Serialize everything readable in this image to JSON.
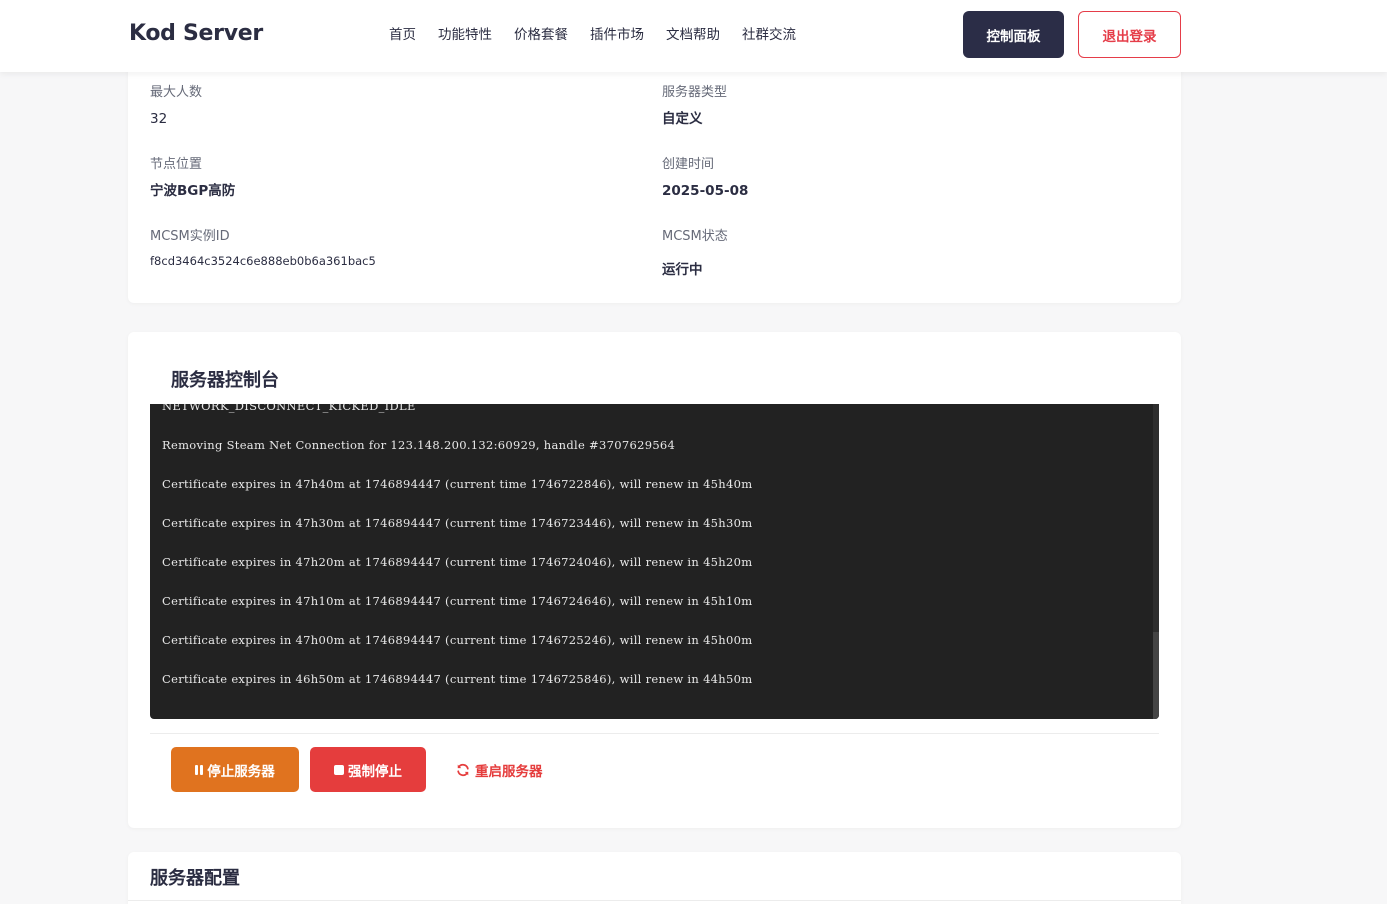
{
  "brand": {
    "name": "Kod Server"
  },
  "nav": {
    "links": [
      "首页",
      "功能特性",
      "价格套餐",
      "插件市场",
      "文档帮助",
      "社群交流"
    ],
    "dashboard_label": "控制面板",
    "logout_label": "退出登录"
  },
  "server_info": {
    "max_players_label": "最大人数",
    "max_players_value": "32",
    "server_type_label": "服务器类型",
    "server_type_value": "自定义",
    "node_label": "节点位置",
    "node_value": "宁波BGP高防",
    "created_label": "创建时间",
    "created_value": "2025-05-08",
    "mcsm_id_label": "MCSM实例ID",
    "mcsm_id_value": "f8cd3464c3524c6e888eb0b6a361bac5",
    "mcsm_status_label": "MCSM状态",
    "mcsm_status_value": "运行中"
  },
  "console": {
    "title": "服务器控制台",
    "lines": [
      "NETWORK_DISCONNECT_KICKED_IDLE",
      "Removing Steam Net Connection for 123.148.200.132:60929, handle #3707629564",
      "Certificate expires in 47h40m at 1746894447 (current time 1746722846), will renew in 45h40m",
      "Certificate expires in 47h30m at 1746894447 (current time 1746723446), will renew in 45h30m",
      "Certificate expires in 47h20m at 1746894447 (current time 1746724046), will renew in 45h20m",
      "Certificate expires in 47h10m at 1746894447 (current time 1746724646), will renew in 45h10m",
      "Certificate expires in 47h00m at 1746894447 (current time 1746725246), will renew in 45h00m",
      "Certificate expires in 46h50m at 1746894447 (current time 1746725846), will renew in 44h50m"
    ],
    "stop_label": "停止服务器",
    "force_stop_label": "强制停止",
    "restart_label": "重启服务器"
  },
  "config": {
    "title": "服务器配置"
  },
  "colors": {
    "primary_dark": "#2b2d47",
    "danger": "#e53d49",
    "warning": "#e0731f",
    "terminal_bg": "#222222"
  }
}
